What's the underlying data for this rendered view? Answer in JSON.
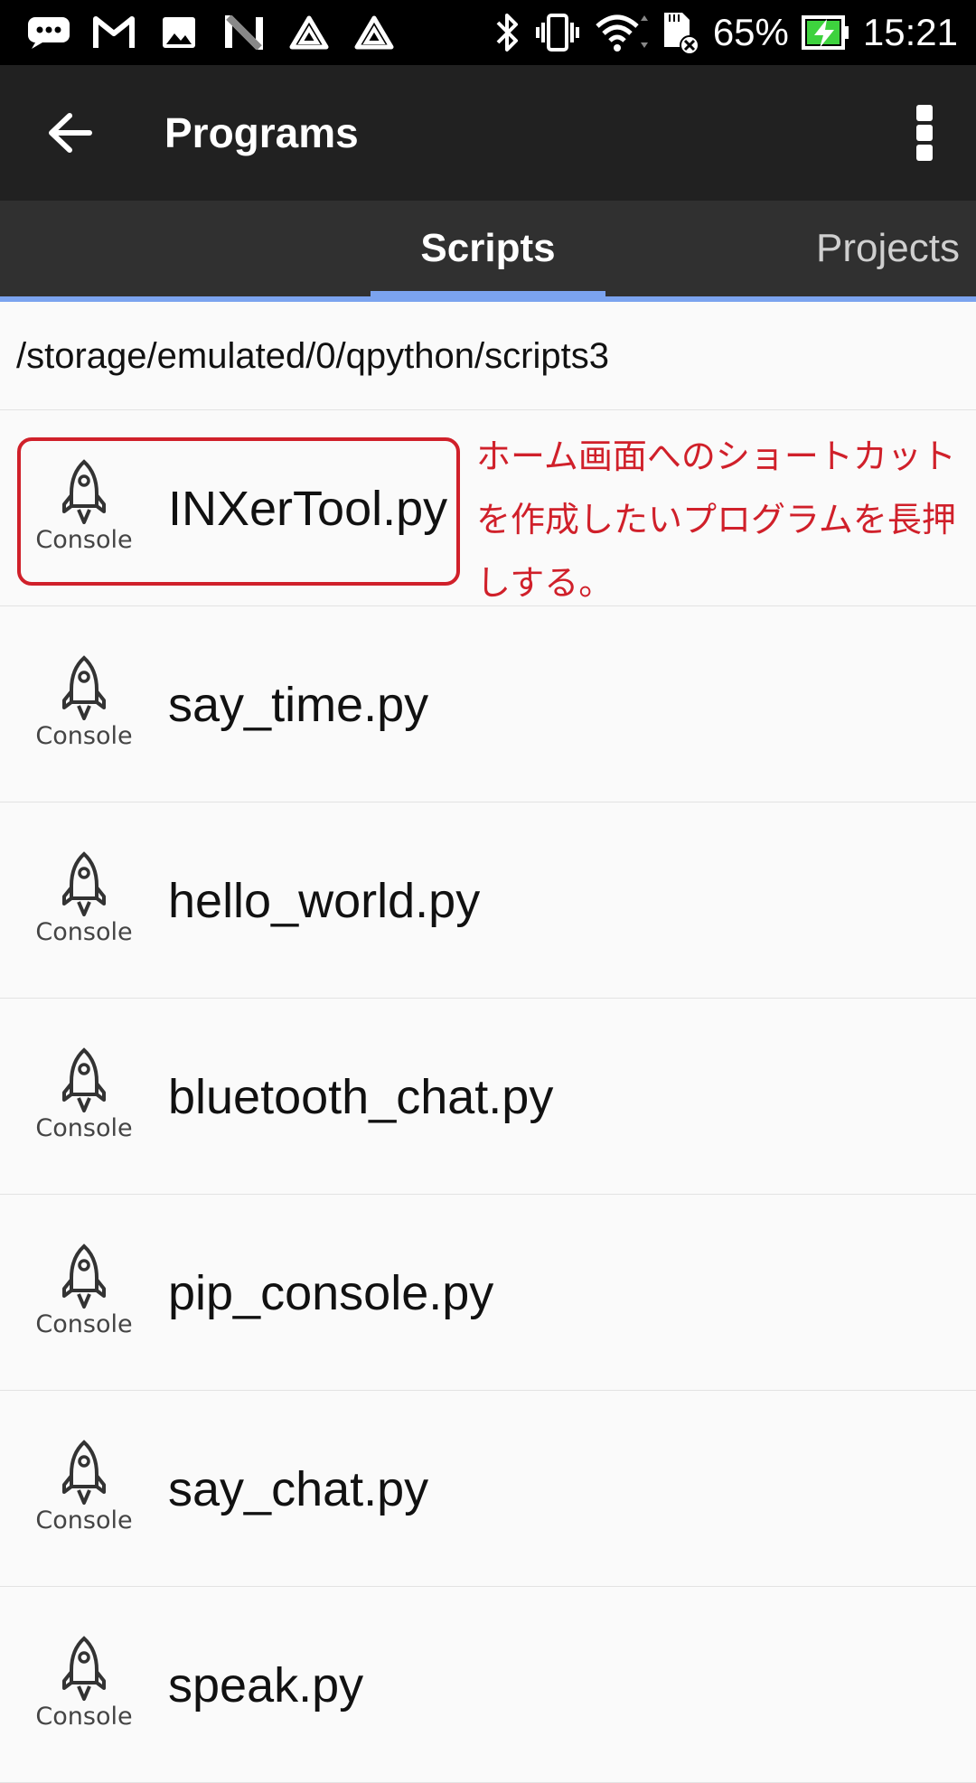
{
  "status_bar": {
    "battery_percent": "65%",
    "time": "15:21",
    "left_icons": [
      "chat-icon",
      "gmail-icon",
      "gallery-icon",
      "n-icon",
      "triangle-icon",
      "triangle-icon"
    ],
    "right_icons": [
      "bluetooth-icon",
      "vibrate-icon",
      "wifi-icon",
      "sdcard-icon",
      "battery-charging-icon"
    ]
  },
  "toolbar": {
    "title": "Programs"
  },
  "tabs": [
    {
      "label": "Scripts",
      "selected": true
    },
    {
      "label": "Projects",
      "selected": false
    }
  ],
  "path": "/storage/emulated/0/qpython/scripts3",
  "icon_caption": "Console",
  "files": [
    {
      "name": "INXerTool.py",
      "caption": "Console"
    },
    {
      "name": "say_time.py",
      "caption": "Console"
    },
    {
      "name": "hello_world.py",
      "caption": "Console"
    },
    {
      "name": "bluetooth_chat.py",
      "caption": "Console"
    },
    {
      "name": "pip_console.py",
      "caption": "Console"
    },
    {
      "name": "say_chat.py",
      "caption": "Console"
    },
    {
      "name": "speak.py",
      "caption": "Console"
    }
  ],
  "annotation": "ホーム画面へのショートカットを作成したいプログラムを長押しする。",
  "colors": {
    "toolbar": "#212121",
    "tabbar": "#303030",
    "tab_indicator": "#7ba3ef",
    "annotation": "#d0202a"
  }
}
